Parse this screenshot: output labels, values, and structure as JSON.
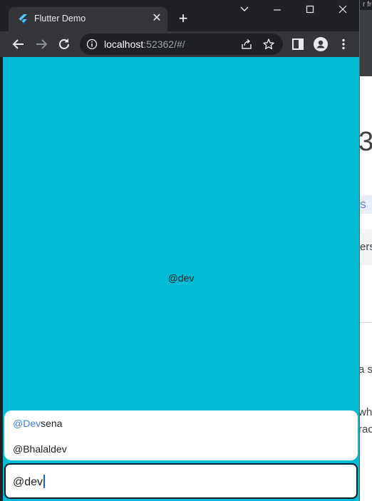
{
  "background_page": {
    "top_text": "r fro",
    "big_text": "3",
    "tab_text": "S",
    "box_text": "ers",
    "line1": "a s",
    "line2": "wh",
    "line3": "rac"
  },
  "browser": {
    "tab_title": "Flutter Demo",
    "url_host": "localhost",
    "url_rest": ":52362/#/"
  },
  "app": {
    "display_text": "@dev",
    "suggestions": [
      {
        "highlight": "@Dev",
        "rest": "sena"
      },
      {
        "highlight": "",
        "rest": "@Bhalaldev"
      }
    ],
    "input_value": "@dev"
  },
  "colors": {
    "content_bg": "#00bcd4",
    "highlight": "#3f7fd6"
  }
}
